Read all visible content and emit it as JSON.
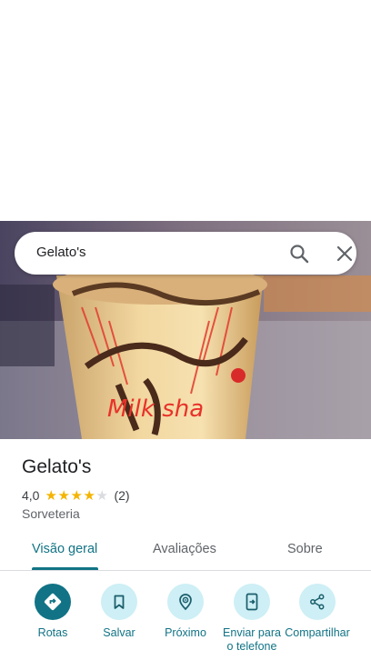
{
  "search": {
    "query": "Gelato's"
  },
  "place": {
    "title": "Gelato's",
    "rating": "4,0",
    "rating_fraction": 0.8,
    "review_count": "(2)",
    "category": "Sorveteria"
  },
  "tabs": [
    {
      "label": "Visão geral",
      "active": true
    },
    {
      "label": "Avaliações",
      "active": false
    },
    {
      "label": "Sobre",
      "active": false
    }
  ],
  "actions": [
    {
      "label": "Rotas",
      "icon": "directions-icon"
    },
    {
      "label": "Salvar",
      "icon": "bookmark-icon"
    },
    {
      "label": "Próximo",
      "icon": "nearby-icon"
    },
    {
      "label": "Enviar para o telefone",
      "icon": "send-to-phone-icon"
    },
    {
      "label": "Compartilhar",
      "icon": "share-icon"
    }
  ],
  "colors": {
    "accent": "#117385",
    "action_bg": "#cdeff5",
    "star": "#f4b400"
  }
}
